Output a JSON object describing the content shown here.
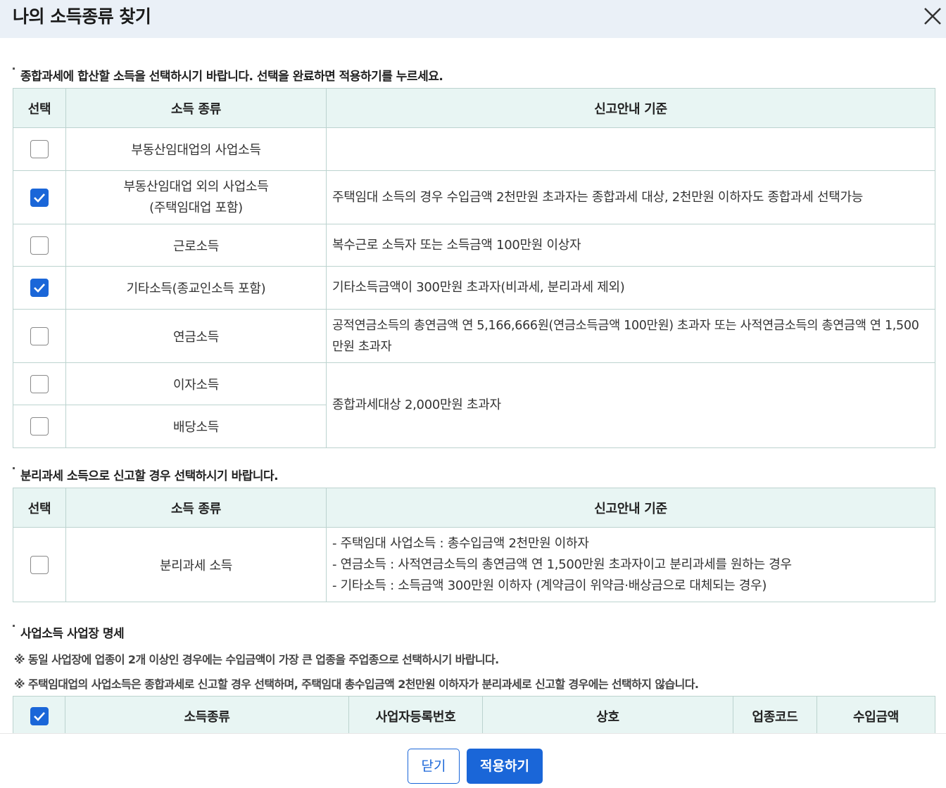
{
  "dialog": {
    "title": "나의 소득종류 찾기",
    "close_icon": "close-icon"
  },
  "section1": {
    "title": "종합과세에 합산할 소득을 선택하시기 바랍니다. 선택을 완료하면 적용하기를 누르세요.",
    "headers": [
      "선택",
      "소득 종류",
      "신고안내 기준"
    ],
    "rows": [
      {
        "checked": false,
        "type": "부동산임대업의 사업소득",
        "criteria": ""
      },
      {
        "checked": true,
        "type_line1": "부동산임대업 외의 사업소득",
        "type_line2": "(주택임대업 포함)",
        "criteria": "주택임대 소득의 경우 수입금액 2천만원 초과자는 종합과세 대상, 2천만원 이하자도 종합과세 선택가능"
      },
      {
        "checked": false,
        "type": "근로소득",
        "criteria": "복수근로 소득자 또는 소득금액 100만원 이상자"
      },
      {
        "checked": true,
        "type": "기타소득(종교인소득 포함)",
        "criteria": "기타소득금액이 300만원 초과자(비과세, 분리과세 제외)"
      },
      {
        "checked": false,
        "type": "연금소득",
        "criteria": "공적연금소득의 총연금액 연 5,166,666원(연금소득금액 100만원) 초과자 또는 사적연금소득의 총연금액 연 1,500만원 초과자"
      },
      {
        "checked": false,
        "type": "이자소득",
        "criteria": "종합과세대상 2,000만원 초과자"
      },
      {
        "checked": false,
        "type": "배당소득"
      }
    ]
  },
  "section2": {
    "title": "분리과세 소득으로 신고할 경우 선택하시기 바랍니다.",
    "headers": [
      "선택",
      "소득 종류",
      "신고안내 기준"
    ],
    "row": {
      "checked": false,
      "type": "분리과세 소득",
      "criteria": [
        "- 주택임대 사업소득 : 총수입금액 2천만원 이하자",
        "- 연금소득 : 사적연금소득의 총연금액 연 1,500만원 초과자이고 분리과세를 원하는 경우",
        "- 기타소득 : 소득금액 300만원 이하자 (계약금이 위약금·배상금으로 대체되는 경우)"
      ]
    }
  },
  "section3": {
    "title": "사업소득 사업장 명세",
    "notes": [
      "※ 동일 사업장에 업종이 2개 이상인 경우에는 수입금액이 가장 큰 업종을 주업종으로 선택하시기 바랍니다.",
      "※ 주택임대업의 사업소득은 종합과세로 신고할 경우 선택하며, 주택임대 총수입금액 2천만원 이하자가 분리과세로 신고할 경우에는 선택하지 않습니다."
    ],
    "header_checked": true,
    "headers": [
      "소득종류",
      "사업자등록번호",
      "상호",
      "업종코드",
      "수입금액"
    ]
  },
  "footer": {
    "close_label": "닫기",
    "apply_label": "적용하기"
  },
  "colors": {
    "accent": "#1a66d8",
    "header_bg": "#eaf0f7",
    "table_header_bg": "#e8f5f3",
    "table_border": "#bcd3cf"
  }
}
